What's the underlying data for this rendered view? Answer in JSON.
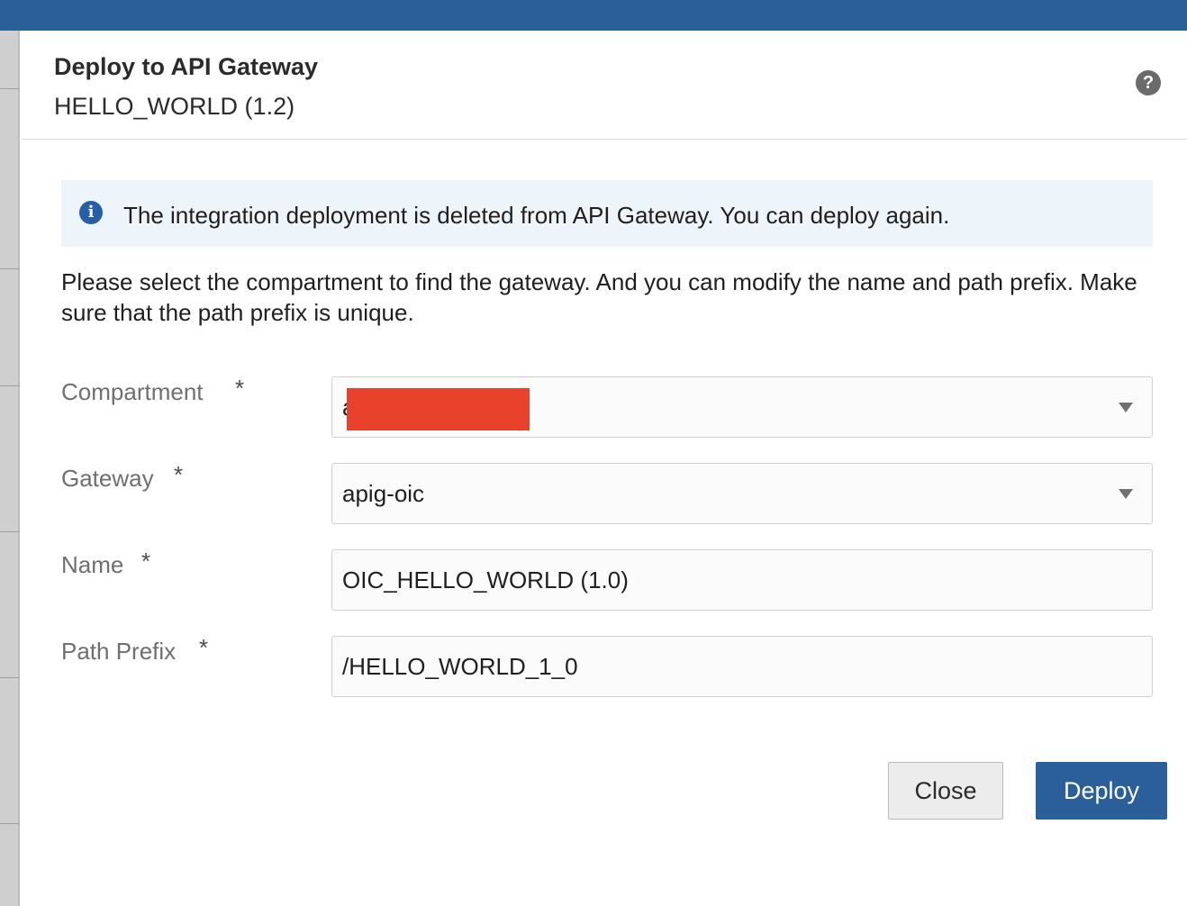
{
  "colors": {
    "top_bar": "#2a5f98",
    "primary_button": "#2b5f99",
    "info_background": "#eef5fa",
    "redaction": "#e8412c"
  },
  "dialog": {
    "title": "Deploy to API Gateway",
    "subtitle": "HELLO_WORLD (1.2)",
    "help_icon": "?"
  },
  "info": {
    "icon": "i",
    "message": "The integration deployment is deleted from API Gateway. You can deploy again."
  },
  "instructions": "Please select the compartment to find the gateway. And you can modify the name and path prefix. Make sure that the path prefix is unique.",
  "form": {
    "required_marker": "*",
    "compartment": {
      "label": "Compartment",
      "value": "a",
      "type": "select",
      "value_redacted": true
    },
    "gateway": {
      "label": "Gateway",
      "value": "apig-oic",
      "type": "select"
    },
    "name": {
      "label": "Name",
      "value": "OIC_HELLO_WORLD (1.0)",
      "type": "text"
    },
    "path_prefix": {
      "label": "Path Prefix",
      "value": "/HELLO_WORLD_1_0",
      "type": "text"
    }
  },
  "buttons": {
    "close": "Close",
    "deploy": "Deploy"
  }
}
